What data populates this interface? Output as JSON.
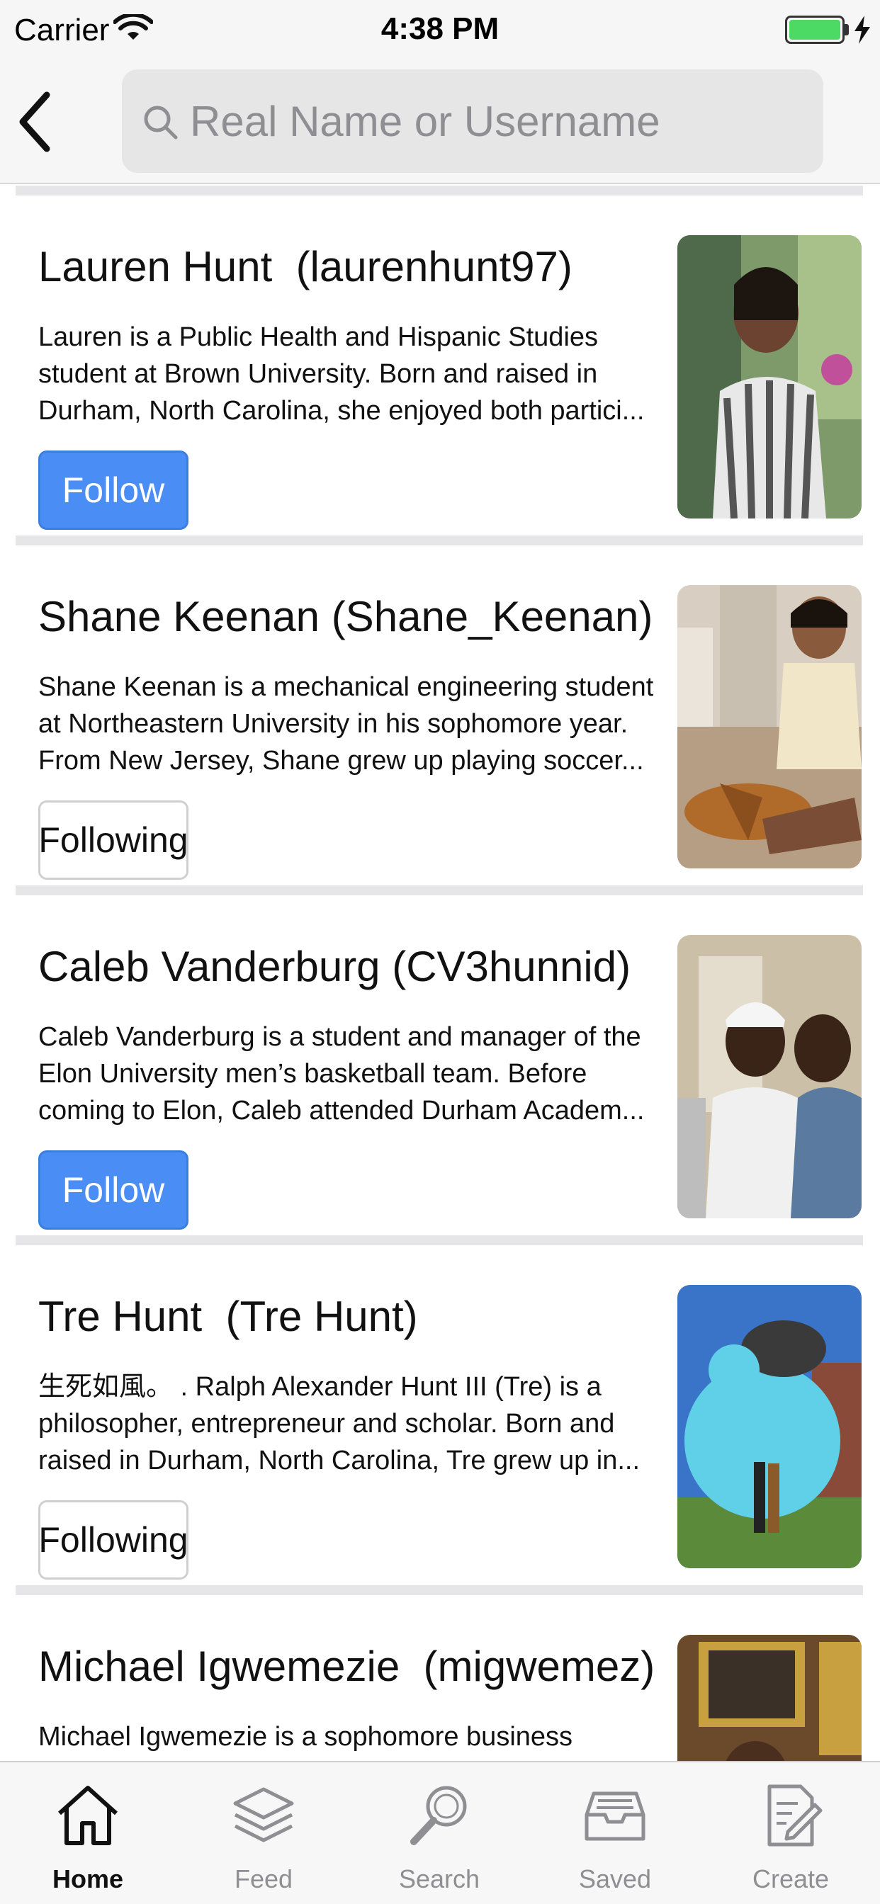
{
  "status_bar": {
    "carrier": "Carrier",
    "time": "4:38 PM"
  },
  "search": {
    "placeholder": "Real Name or Username"
  },
  "users": [
    {
      "name": "Lauren Hunt  (laurenhunt97)",
      "bio": "     Lauren is a Public Health and Hispanic Studies\nstudent at Brown University. Born and raised in\nDurham, North Carolina, she enjoyed both partici...",
      "button": "Follow",
      "state": "follow"
    },
    {
      "name": "Shane Keenan (Shane_Keenan)",
      "bio": "Shane Keenan is a mechanical engineering student\nat Northeastern University in his sophomore year.\nFrom New Jersey, Shane grew up playing soccer...",
      "button": "Following",
      "state": "following"
    },
    {
      "name": "Caleb Vanderburg (CV3hunnid)",
      "bio": "Caleb Vanderburg is a student and manager of the\nElon University men’s basketball team. Before\ncoming to Elon, Caleb attended Durham Academ...",
      "button": "Follow",
      "state": "follow"
    },
    {
      "name": "Tre Hunt  (Tre Hunt)",
      "bio": "生死如風。 . Ralph Alexander Hunt III (Tre) is a\nphilosopher, entrepreneur and scholar. Born and\nraised in Durham, North Carolina, Tre grew up in...",
      "button": "Following",
      "state": "following"
    },
    {
      "name": "Michael Igwemezie  (migwemez)",
      "bio": "Michael Igwemezie is a sophomore business\nstudent at the University of Maryland, College",
      "button": "",
      "state": "none"
    }
  ],
  "tabs": [
    {
      "label": "Home",
      "icon": "home-icon",
      "active": true
    },
    {
      "label": "Feed",
      "icon": "layers-icon",
      "active": false
    },
    {
      "label": "Search",
      "icon": "magnifier-icon",
      "active": false
    },
    {
      "label": "Saved",
      "icon": "archive-box-icon",
      "active": false
    },
    {
      "label": "Create",
      "icon": "compose-icon",
      "active": false
    }
  ],
  "colors": {
    "accent": "#4a8ef5",
    "battery": "#4cd964",
    "divider": "#e6e6e8"
  }
}
